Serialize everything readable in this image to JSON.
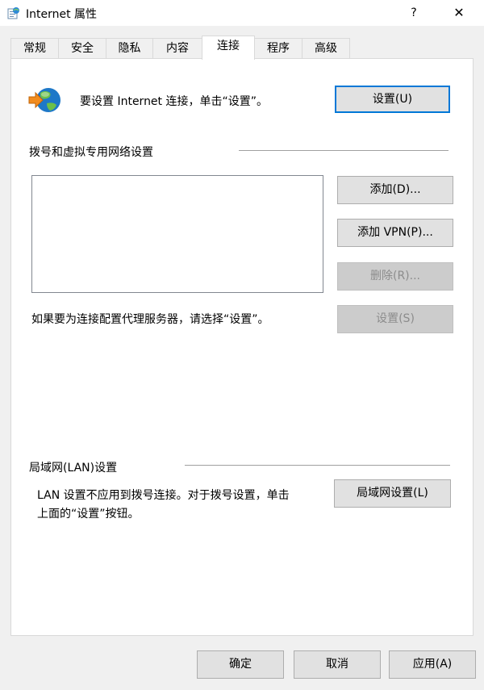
{
  "window": {
    "title": "Internet 属性",
    "help_label": "?",
    "close_label": "✕"
  },
  "tabs": [
    {
      "label": "常规"
    },
    {
      "label": "安全"
    },
    {
      "label": "隐私"
    },
    {
      "label": "内容"
    },
    {
      "label": "连接",
      "active": true
    },
    {
      "label": "程序"
    },
    {
      "label": "高级"
    }
  ],
  "setup": {
    "icon": "globe-arrow-icon",
    "text": "要设置 Internet 连接，单击“设置”。",
    "button": "设置(U)"
  },
  "dialup": {
    "heading": "拨号和虚拟专用网络设置",
    "add_button": "添加(D)...",
    "add_vpn_button": "添加 VPN(P)...",
    "remove_button": "删除(R)...",
    "settings_button": "设置(S)",
    "proxy_hint": "如果要为连接配置代理服务器，请选择“设置”。"
  },
  "lan": {
    "heading": "局域网(LAN)设置",
    "description_line1": "LAN 设置不应用到拨号连接。对于拨号设置，单击",
    "description_line2": "上面的“设置”按钮。",
    "button": "局域网设置(L)"
  },
  "footer": {
    "ok": "确定",
    "cancel": "取消",
    "apply": "应用(A)"
  },
  "colors": {
    "accent": "#0078d7",
    "dialog_bg": "#f0f0f0",
    "disabled_text": "#8c8c8c"
  }
}
